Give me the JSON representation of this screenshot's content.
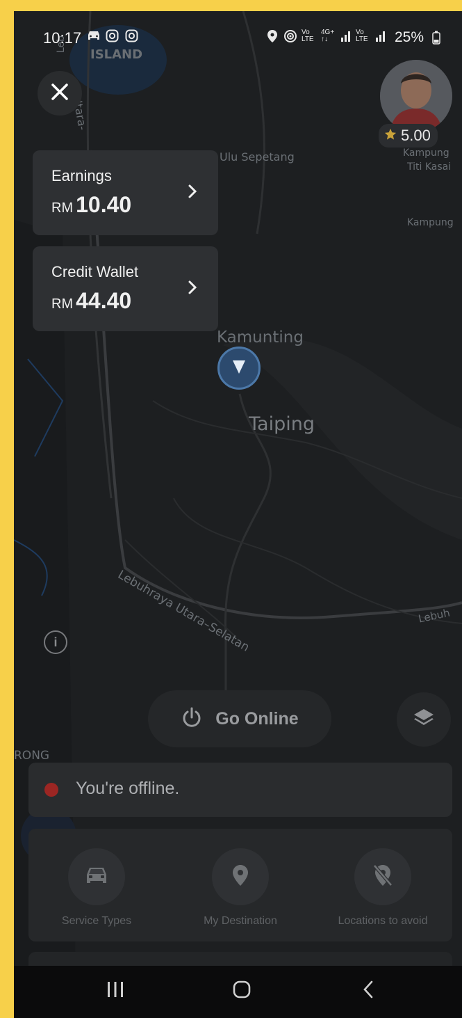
{
  "status_bar": {
    "time": "10:17",
    "notification_icons": [
      "car-icon",
      "instagram-icon",
      "instagram-icon"
    ],
    "signal_icons": [
      "location-icon",
      "hotspot-icon",
      "volte-lte1-icon",
      "4g-plus-icon",
      "signal-bars-icon",
      "volte-lte2-icon",
      "signal-bars-icon"
    ],
    "battery_percent": "25%"
  },
  "map": {
    "labels": {
      "island": "ISLAND",
      "ulu_sepetang": "Ulu Sepetang",
      "kampung_titi_kasai": "Kampung",
      "titi_kasai": "Titi Kasai",
      "kampung2": "Kampung",
      "kamunting": "Kamunting",
      "taiping": "Taiping",
      "highway": "Lebuhraya Utara–Selatan",
      "lebuh": "Lebuh",
      "rong": "RONG",
      "utara": "Utara-",
      "leb": "Leb"
    }
  },
  "profile": {
    "rating": "5.00"
  },
  "earnings_card": {
    "label": "Earnings",
    "currency": "RM",
    "amount": "10.40"
  },
  "wallet_card": {
    "label": "Credit Wallet",
    "currency": "RM",
    "amount": "44.40"
  },
  "go_online": {
    "label": "Go Online"
  },
  "offline_banner": {
    "message": "You're offline.",
    "dot_color": "#9c2623"
  },
  "options": [
    {
      "label": "Service Types",
      "icon": "car-icon"
    },
    {
      "label": "My Destination",
      "icon": "location-pin-icon"
    },
    {
      "label": "Locations to avoid",
      "icon": "avoid-location-icon"
    }
  ],
  "colors": {
    "frame": "#f7d04a",
    "map_bg": "#1d1f21",
    "pin": "#4c78a8"
  }
}
